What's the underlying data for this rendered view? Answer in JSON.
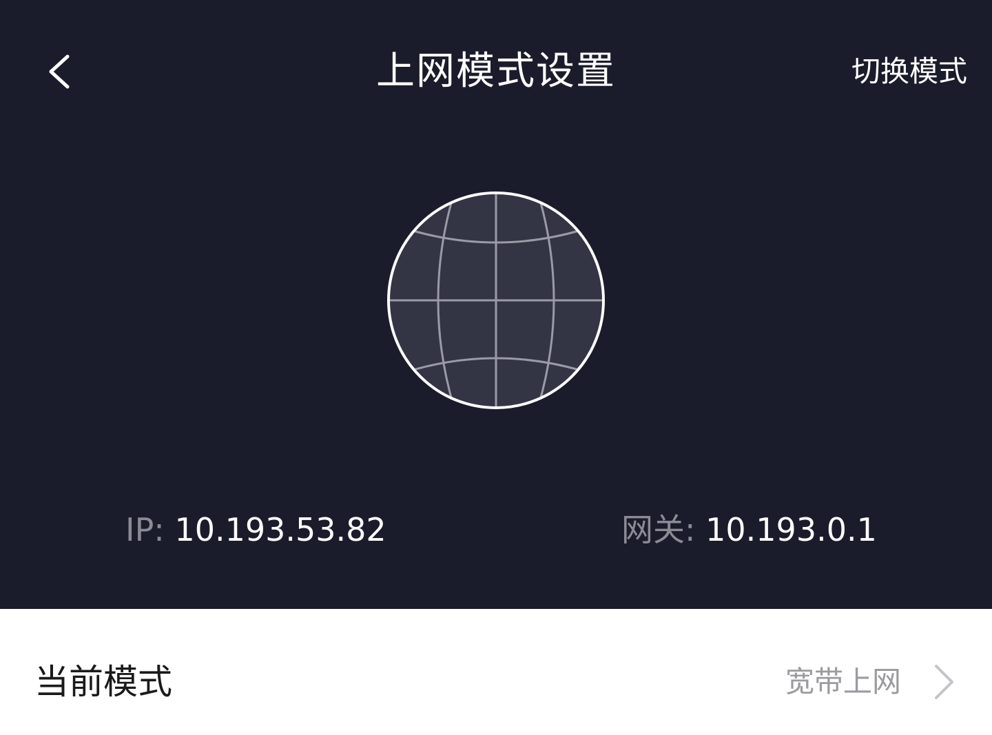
{
  "header": {
    "title": "上网模式设置",
    "action_label": "切换模式",
    "back_icon": "chevron-left-icon"
  },
  "hero": {
    "icon": "globe-icon",
    "ip": {
      "label": "IP:",
      "value": "10.193.53.82"
    },
    "gateway": {
      "label": "网关:",
      "value": "10.193.0.1"
    }
  },
  "current_mode": {
    "label": "当前模式",
    "value": "宽带上网",
    "chevron_icon": "chevron-right-icon"
  },
  "colors": {
    "hero_background": "#1b1c2b",
    "globe_fill": "#333545",
    "muted_label": "#8a8b94",
    "row_value": "#9b9ba0"
  }
}
